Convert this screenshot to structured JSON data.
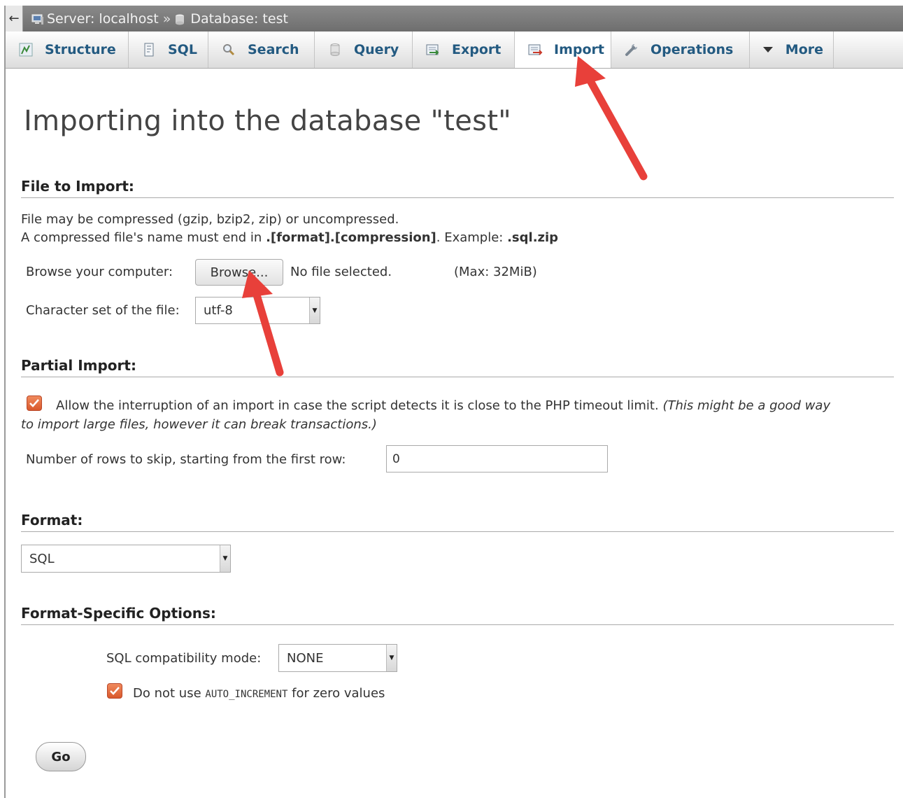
{
  "breadcrumb": {
    "back": "←",
    "server": "Server: localhost",
    "separator": "»",
    "database": "Database: test"
  },
  "tabs": [
    {
      "label": "Structure",
      "icon": "structure-icon"
    },
    {
      "label": "SQL",
      "icon": "sql-icon"
    },
    {
      "label": "Search",
      "icon": "search-icon"
    },
    {
      "label": "Query",
      "icon": "query-icon"
    },
    {
      "label": "Export",
      "icon": "export-icon"
    },
    {
      "label": "Import",
      "icon": "import-icon",
      "active": true
    },
    {
      "label": "Operations",
      "icon": "wrench-icon"
    },
    {
      "label": "More",
      "icon": "triangle-down-icon"
    }
  ],
  "page": {
    "title": "Importing into the database \"test\""
  },
  "file_import": {
    "heading": "File to Import:",
    "note_line1": "File may be compressed (gzip, bzip2, zip) or uncompressed.",
    "note_line2_prefix": "A compressed file's name must end in ",
    "note_line2_bold1": ".[format].[compression]",
    "note_line2_mid": ". Example: ",
    "note_line2_bold2": ".sql.zip",
    "browse_label": "Browse your computer:",
    "browse_button": "Browse...",
    "no_file": "No file selected.",
    "max_size": "(Max: 32MiB)",
    "charset_label": "Character set of the file:",
    "charset_value": "utf-8"
  },
  "partial_import": {
    "heading": "Partial Import:",
    "allow_interrupt_text": "Allow the interruption of an import in case the script detects it is close to the PHP timeout limit.",
    "allow_interrupt_italic_1": "(This might be a good way",
    "allow_interrupt_italic_2": "to import large files, however it can break transactions.)",
    "skip_label": "Number of rows to skip, starting from the first row:",
    "skip_value": "0"
  },
  "format": {
    "heading": "Format:",
    "value": "SQL"
  },
  "format_options": {
    "heading": "Format-Specific Options:",
    "compat_label": "SQL compatibility mode:",
    "compat_value": "NONE",
    "auto_inc_prefix": "Do not use ",
    "auto_inc_code": "AUTO_INCREMENT",
    "auto_inc_suffix": " for zero values"
  },
  "submit": {
    "go": "Go"
  },
  "colors": {
    "tab_text": "#235a81",
    "checkbox": "#e06a3c",
    "annotation_arrow": "#e8403a"
  }
}
